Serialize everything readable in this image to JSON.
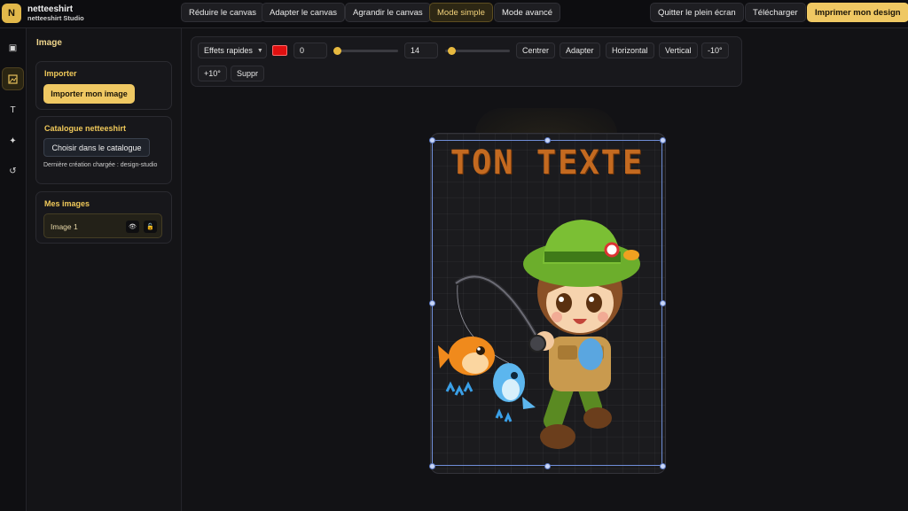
{
  "header": {
    "logo_letter": "N",
    "brand_name": "netteeshirt",
    "brand_sub": "netteeshirt Studio",
    "buttons": {
      "reduce": "Réduire le canvas",
      "fit": "Adapter le canvas",
      "enlarge": "Agrandir le canvas",
      "simple": "Mode simple",
      "advanced": "Mode avancé",
      "exit_fullscreen": "Quitter le plein écran",
      "download": "Télécharger",
      "print": "Imprimer mon design"
    }
  },
  "rail": {
    "icons": [
      "layers-icon",
      "image-icon",
      "text-icon",
      "sparkle-icon",
      "history-icon"
    ],
    "glyphs": {
      "layers": "▣",
      "image": "🖼",
      "text": "T",
      "sparkle": "✦",
      "history": "↺"
    }
  },
  "panel": {
    "title": "Image",
    "import": {
      "title": "Importer",
      "button": "Importer mon image"
    },
    "catalogue": {
      "title": "Catalogue netteeshirt",
      "button": "Choisir dans le catalogue",
      "note": "Dernière création chargée : design-studio"
    },
    "my_images": {
      "title": "Mes images",
      "items": [
        {
          "label": "Image 1"
        }
      ],
      "eye_glyph": "👁",
      "lock_glyph": "🔓"
    }
  },
  "toolbar": {
    "effects": "Effets rapides",
    "color": "#e01010",
    "value_1": "0",
    "value_1_level": 0,
    "value_2": "14",
    "value_2_level": 0.05,
    "buttons": {
      "center": "Centrer",
      "fit": "Adapter",
      "horizontal": "Horizontal",
      "vertical": "Vertical",
      "rot_minus": "-10°",
      "rot_plus": "+10°",
      "delete": "Suppr"
    }
  },
  "canvas": {
    "text": "TON TEXTE",
    "text_color": "#c46a20"
  },
  "colors": {
    "accent": "#efc863",
    "selection": "#6f8ed8"
  }
}
